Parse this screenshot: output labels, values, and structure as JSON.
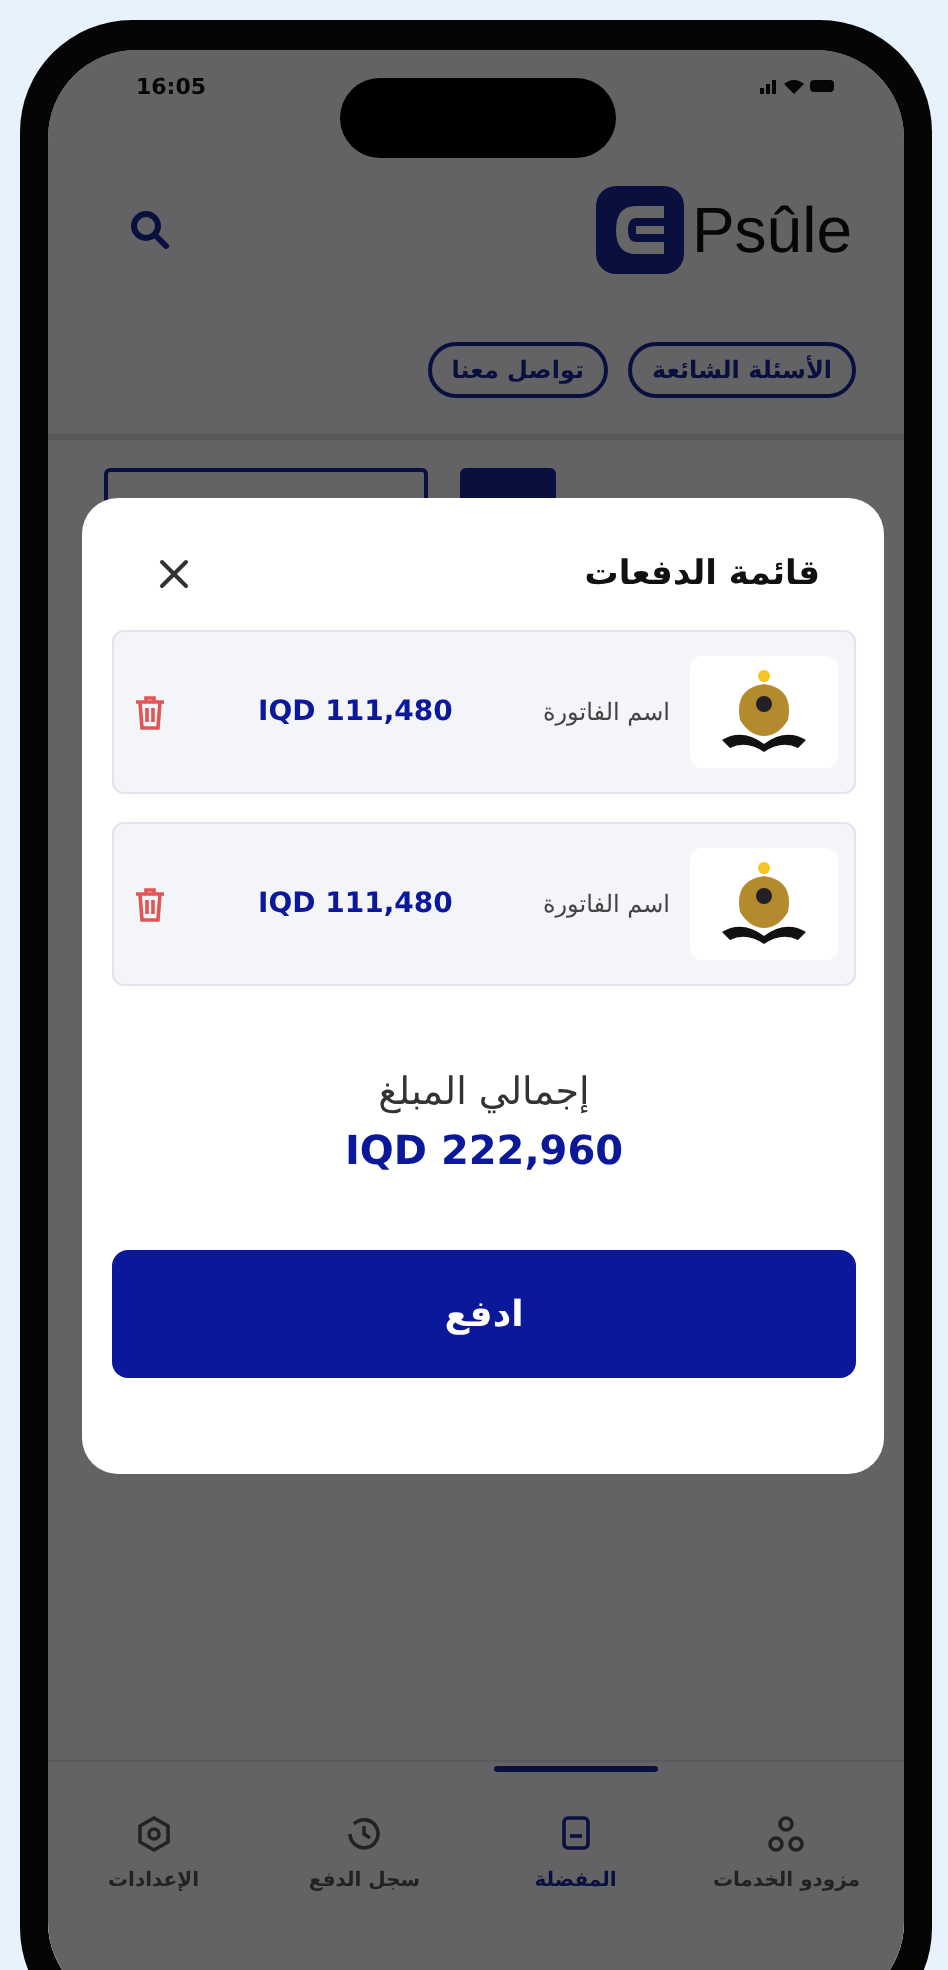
{
  "status_bar": {
    "time": "16:05"
  },
  "header": {
    "logo_text": "Psûle"
  },
  "chips": [
    {
      "label": "الأسئلة الشائعة"
    },
    {
      "label": "تواصل معنا"
    }
  ],
  "modal": {
    "title": "قائمة الدفعات",
    "items": [
      {
        "name": "اسم الفاتورة",
        "amount": "IQD 111,480"
      },
      {
        "name": "اسم الفاتورة",
        "amount": "IQD 111,480"
      }
    ],
    "total_label": "إجمالي المبلغ",
    "total": "IQD 222,960",
    "pay_button": "ادفع"
  },
  "bottom_nav": [
    {
      "label": "مزودو الخدمات",
      "selected": false
    },
    {
      "label": "المفضلة",
      "selected": true
    },
    {
      "label": "سجل الدفع",
      "selected": false
    },
    {
      "label": "الإعدادات",
      "selected": false
    }
  ]
}
